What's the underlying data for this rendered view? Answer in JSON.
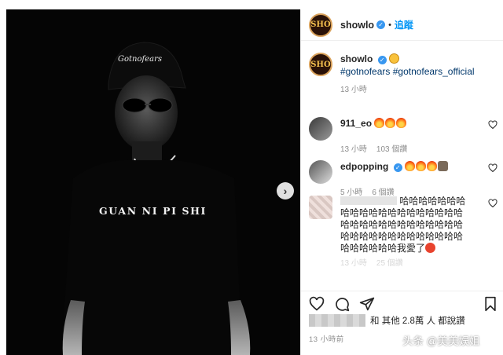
{
  "post": {
    "image": {
      "shirt_text": "GUAN NI PI SHI",
      "cap_text": "Gotnofears"
    },
    "header": {
      "avatar_text": "SHO",
      "username": "showlo",
      "separator": "•",
      "follow_label": "追蹤"
    },
    "caption": {
      "username": "showlo",
      "hashtags": "#gotnofears #gotnofears_official",
      "time": "13 小時"
    },
    "comments": [
      {
        "username": "911_eo",
        "time": "13 小時",
        "likes": "103 個讚"
      },
      {
        "username": "edpopping",
        "time": "5 小時",
        "likes": "6 個讚"
      },
      {
        "text_line1": "哈哈哈哈哈哈哈",
        "text_line2": "哈哈哈哈哈哈哈哈哈哈哈哈哈",
        "text_line3": "哈哈哈哈哈哈哈哈哈哈哈哈哈",
        "text_line4": "哈哈哈哈哈哈哈哈哈哈哈哈哈",
        "text_line5": "哈哈哈哈哈哈我愛了",
        "time": "13 小時",
        "likes": "25 個讚"
      }
    ],
    "likes_text": "和 其他 2.8萬 人 都說讚",
    "timestamp": "13 小時前"
  },
  "watermark": "头条 @美美娱姐",
  "colors": {
    "link": "#0095f6",
    "hashtag": "#00376b",
    "muted": "#8e8e8e",
    "verified": "#3897f0"
  }
}
